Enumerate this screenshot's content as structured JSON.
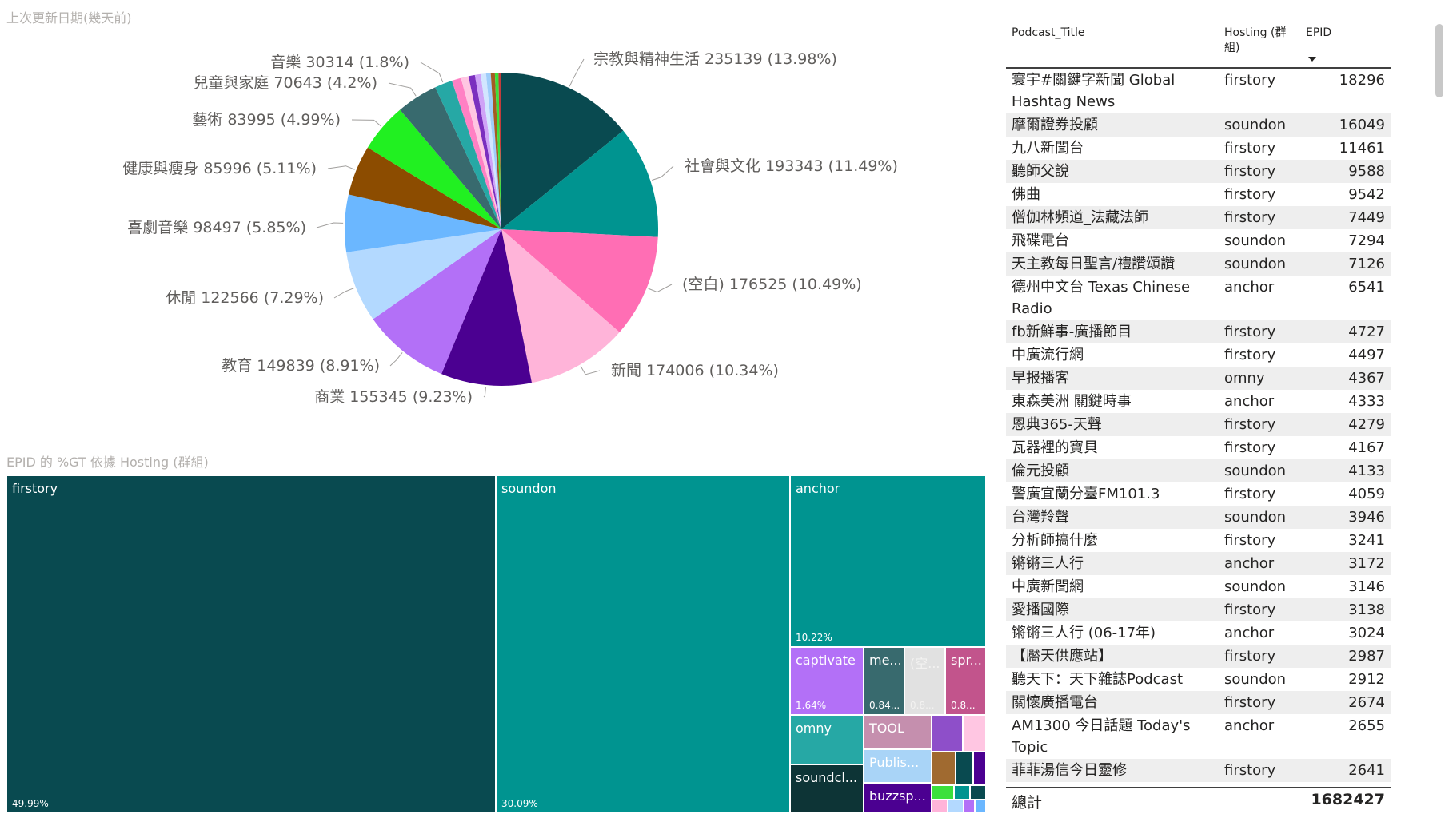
{
  "pie_title": "上次更新日期(幾天前)",
  "treemap_title": "EPID 的 %GT 依據 Hosting (群組)",
  "chart_data": [
    {
      "type": "pie",
      "slices": [
        {
          "label": "宗教與精神生活",
          "value": 235139,
          "pct": "13.98%",
          "color": "#094a50",
          "text": "宗教與精神生活 235139 (13.98%)"
        },
        {
          "label": "社會與文化",
          "value": 193343,
          "pct": "11.49%",
          "color": "#009490",
          "text": "社會與文化 193343 (11.49%)"
        },
        {
          "label": "(空白)",
          "value": 176525,
          "pct": "10.49%",
          "color": "#ff6eb4",
          "text": "(空白) 176525 (10.49%)"
        },
        {
          "label": "新聞",
          "value": 174006,
          "pct": "10.34%",
          "color": "#ffb4d9",
          "text": "新聞 174006 (10.34%)"
        },
        {
          "label": "商業",
          "value": 155345,
          "pct": "9.23%",
          "color": "#4b0091",
          "text": "商業 155345 (9.23%)"
        },
        {
          "label": "教育",
          "value": 149839,
          "pct": "8.91%",
          "color": "#b370f7",
          "text": "教育 149839 (8.91%)"
        },
        {
          "label": "休閒",
          "value": 122566,
          "pct": "7.29%",
          "color": "#b3d9ff",
          "text": "休閒 122566 (7.29%)"
        },
        {
          "label": "喜劇音樂",
          "value": 98497,
          "pct": "5.85%",
          "color": "#6bb7ff",
          "text": "喜劇音樂 98497 (5.85%)"
        },
        {
          "label": "健康與瘦身",
          "value": 85996,
          "pct": "5.11%",
          "color": "#8c4c00",
          "text": "健康與瘦身 85996 (5.11%)"
        },
        {
          "label": "藝術",
          "value": 83995,
          "pct": "4.99%",
          "color": "#21f021",
          "text": "藝術 83995 (4.99%)"
        },
        {
          "label": "兒童與家庭",
          "value": 70643,
          "pct": "4.2%",
          "color": "#386a6e",
          "text": "兒童與家庭 70643 (4.2%)"
        },
        {
          "label": "音樂",
          "value": 30314,
          "pct": "1.8%",
          "color": "#26a8a5",
          "text": "音樂 30314 (1.8%)"
        },
        {
          "label": "",
          "value": 16000,
          "pct": "",
          "color": "#ff80c4",
          "text": ""
        },
        {
          "label": "",
          "value": 13000,
          "pct": "",
          "color": "#ffc6e2",
          "text": ""
        },
        {
          "label": "",
          "value": 11000,
          "pct": "",
          "color": "#7b2fbf",
          "text": ""
        },
        {
          "label": "",
          "value": 10000,
          "pct": "",
          "color": "#cfa3f7",
          "text": ""
        },
        {
          "label": "",
          "value": 9000,
          "pct": "",
          "color": "#d2e6ff",
          "text": ""
        },
        {
          "label": "",
          "value": 8000,
          "pct": "",
          "color": "#9fcdfa",
          "text": ""
        },
        {
          "label": "",
          "value": 7000,
          "pct": "",
          "color": "#a45c22",
          "text": ""
        },
        {
          "label": "",
          "value": 6000,
          "pct": "",
          "color": "#3be03b",
          "text": ""
        },
        {
          "label": "",
          "value": 5000,
          "pct": "",
          "color": "#c23c3c",
          "text": ""
        }
      ]
    },
    {
      "type": "treemap",
      "cells": [
        {
          "name": "firstory",
          "pct": "49.99%",
          "color": "#094a50"
        },
        {
          "name": "soundon",
          "pct": "30.09%",
          "color": "#009490"
        },
        {
          "name": "anchor",
          "pct": "10.22%",
          "color": "#009490"
        },
        {
          "name": "captivate",
          "pct": "1.64%",
          "color": "#b370f7"
        },
        {
          "name": "me...",
          "pct": "0.84...",
          "color": "#386a6e"
        },
        {
          "name": "(空...",
          "pct": "0.8...",
          "color": "#e1e1e1"
        },
        {
          "name": "spr...",
          "pct": "0.8...",
          "color": "#c2548c"
        },
        {
          "name": "omny",
          "pct": "",
          "color": "#26a8a5"
        },
        {
          "name": "TOOL",
          "pct": "",
          "color": "#c58fae"
        },
        {
          "name": "Publis...",
          "pct": "",
          "color": "#a9d4f7"
        },
        {
          "name": "soundcl...",
          "pct": "",
          "color": "#0d3436"
        },
        {
          "name": "buzzsp...",
          "pct": "",
          "color": "#4b0091"
        },
        {
          "name": "",
          "pct": "",
          "color": "#8e4fc9"
        },
        {
          "name": "",
          "pct": "",
          "color": "#ffc6e2"
        },
        {
          "name": "",
          "pct": "",
          "color": "#a06a30"
        },
        {
          "name": "",
          "pct": "",
          "color": "#094a50"
        },
        {
          "name": "",
          "pct": "",
          "color": "#4b0091"
        },
        {
          "name": "",
          "pct": "",
          "color": "#3be03b"
        },
        {
          "name": "",
          "pct": "",
          "color": "#009490"
        },
        {
          "name": "",
          "pct": "",
          "color": "#094a50"
        },
        {
          "name": "",
          "pct": "",
          "color": "#ffb4d9"
        },
        {
          "name": "",
          "pct": "",
          "color": "#b3d9ff"
        },
        {
          "name": "",
          "pct": "",
          "color": "#b370f7"
        },
        {
          "name": "",
          "pct": "",
          "color": "#6bb7ff"
        }
      ]
    },
    {
      "type": "table",
      "columns": [
        "Podcast_Title",
        "Hosting (群組)",
        "EPID"
      ],
      "rows": [
        [
          "寰宇#關鍵字新聞 Global Hashtag News",
          "firstory",
          "18296"
        ],
        [
          "摩爾證券投顧",
          "soundon",
          "16049"
        ],
        [
          "九八新聞台",
          "firstory",
          "11461"
        ],
        [
          "聽師父說",
          "firstory",
          "9588"
        ],
        [
          "佛曲",
          "firstory",
          "9542"
        ],
        [
          "僧伽林頻道_法藏法師",
          "firstory",
          "7449"
        ],
        [
          "飛碟電台",
          "soundon",
          "7294"
        ],
        [
          "天主教每日聖言/禮讚頌讚",
          "soundon",
          "7126"
        ],
        [
          "德州中文台 Texas Chinese Radio",
          "anchor",
          "6541"
        ],
        [
          "fb新鮮事-廣播節目",
          "firstory",
          "4727"
        ],
        [
          "中廣流行網",
          "firstory",
          "4497"
        ],
        [
          "早报播客",
          "omny",
          "4367"
        ],
        [
          "東森美洲 關鍵時事",
          "anchor",
          "4333"
        ],
        [
          "恩典365-天聲",
          "firstory",
          "4279"
        ],
        [
          "瓦器裡的寶貝",
          "firstory",
          "4167"
        ],
        [
          "倫元投顧",
          "soundon",
          "4133"
        ],
        [
          "警廣宜蘭分臺FM101.3",
          "firstory",
          "4059"
        ],
        [
          "台灣羚聲",
          "soundon",
          "3946"
        ],
        [
          "分析師搞什麼",
          "firstory",
          "3241"
        ],
        [
          "锵锵三人行",
          "anchor",
          "3172"
        ],
        [
          "中廣新聞網",
          "soundon",
          "3146"
        ],
        [
          "愛播國際",
          "firstory",
          "3138"
        ],
        [
          "锵锵三人行 (06-17年)",
          "anchor",
          "3024"
        ],
        [
          "【靨天供應站】",
          "firstory",
          "2987"
        ],
        [
          "聽天下：天下雜誌Podcast",
          "soundon",
          "2912"
        ],
        [
          "關懷廣播電台",
          "firstory",
          "2674"
        ],
        [
          "AM1300 今日話題 Today's Topic",
          "anchor",
          "2655"
        ],
        [
          "菲菲湯信今日靈修",
          "firstory",
          "2641"
        ]
      ],
      "total_label": "總計",
      "total_value": "1682427"
    }
  ]
}
